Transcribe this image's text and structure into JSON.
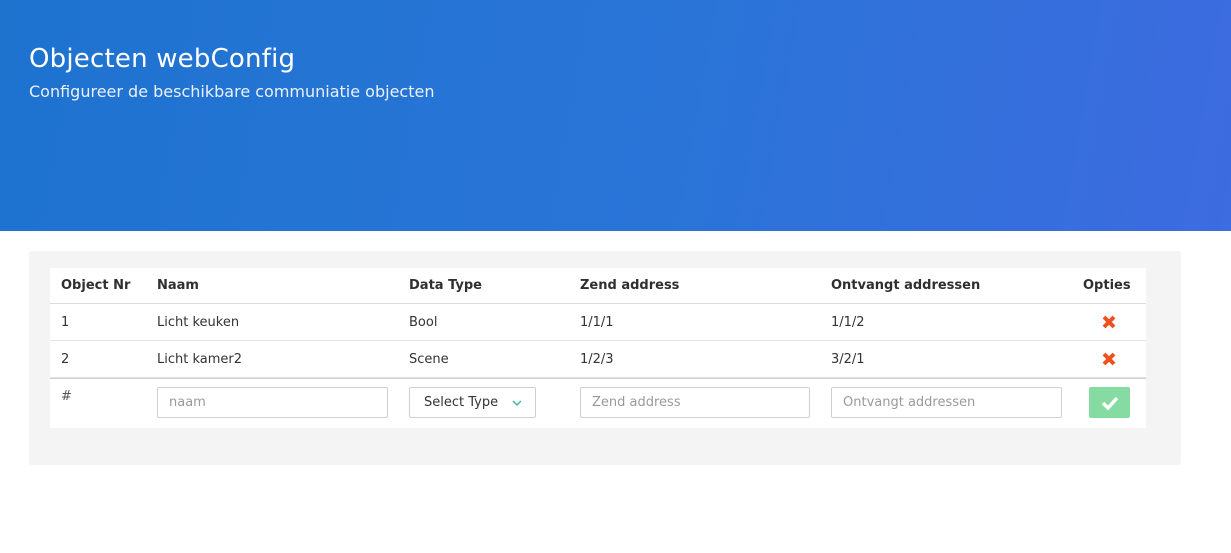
{
  "header": {
    "title": "Objecten webConfig",
    "subtitle": "Configureer de beschikbare communiatie objecten"
  },
  "table": {
    "columns": [
      "Object Nr",
      "Naam",
      "Data Type",
      "Zend address",
      "Ontvangt addressen",
      "Opties"
    ],
    "rows": [
      {
        "nr": "1",
        "naam": "Licht keuken",
        "type": "Bool",
        "zend": "1/1/1",
        "ontvangt": "1/1/2"
      },
      {
        "nr": "2",
        "naam": "Licht kamer2",
        "type": "Scene",
        "zend": "1/2/3",
        "ontvangt": "3/2/1"
      }
    ],
    "new_row": {
      "nr_symbol": "#",
      "naam_placeholder": "naam",
      "type_selected": "Select Type",
      "zend_placeholder": "Zend address",
      "ontvangt_placeholder": "Ontvangt addressen"
    }
  },
  "icons": {
    "delete": "close-icon",
    "confirm": "check-icon",
    "dropdown": "chevron-down-icon"
  },
  "colors": {
    "header_gradient_start": "#1e73cf",
    "header_gradient_end": "#3d6be0",
    "delete_icon": "#f0501e",
    "confirm_button": "#86dba2",
    "chevron": "#3ab5a8"
  }
}
